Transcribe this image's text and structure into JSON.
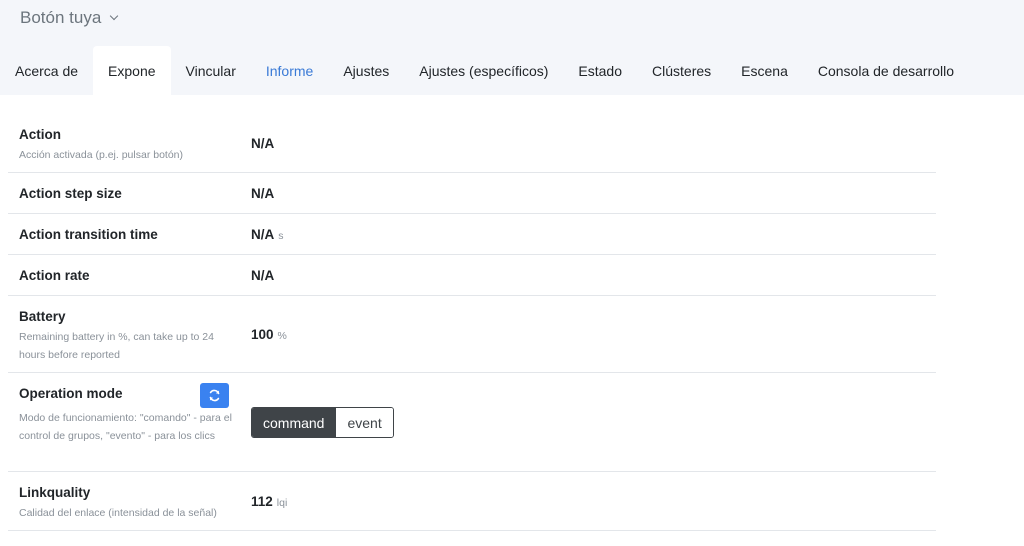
{
  "header": {
    "device_title": "Botón tuya",
    "tabs": [
      {
        "label": "Acerca de"
      },
      {
        "label": "Expone"
      },
      {
        "label": "Vincular"
      },
      {
        "label": "Informe"
      },
      {
        "label": "Ajustes"
      },
      {
        "label": "Ajustes (específicos)"
      },
      {
        "label": "Estado"
      },
      {
        "label": "Clústeres"
      },
      {
        "label": "Escena"
      },
      {
        "label": "Consola de desarrollo"
      }
    ]
  },
  "exposes": {
    "action": {
      "label": "Action",
      "description": "Acción activada (p.ej. pulsar botón)",
      "value": "N/A"
    },
    "action_step_size": {
      "label": "Action step size",
      "value": "N/A"
    },
    "action_transition_time": {
      "label": "Action transition time",
      "value": "N/A",
      "unit": "s"
    },
    "action_rate": {
      "label": "Action rate",
      "value": "N/A"
    },
    "battery": {
      "label": "Battery",
      "description": "Remaining battery in %, can take up to 24 hours before reported",
      "value": "100",
      "unit": "%"
    },
    "operation_mode": {
      "label": "Operation mode",
      "description": "Modo de funcionamiento: \"comando\" - para el control de grupos, \"evento\" - para los clics",
      "options": [
        "command",
        "event"
      ],
      "selected": "command"
    },
    "linkquality": {
      "label": "Linkquality",
      "description": "Calidad del enlace (intensidad de la señal)",
      "value": "112",
      "unit": "lqi"
    }
  },
  "colors": {
    "accent": "#3a82f0",
    "link": "#3a7ad6",
    "toggle_active": "#3f4448"
  },
  "icons": {
    "device_dropdown": "chevron-down-icon",
    "refresh": "refresh-icon"
  }
}
